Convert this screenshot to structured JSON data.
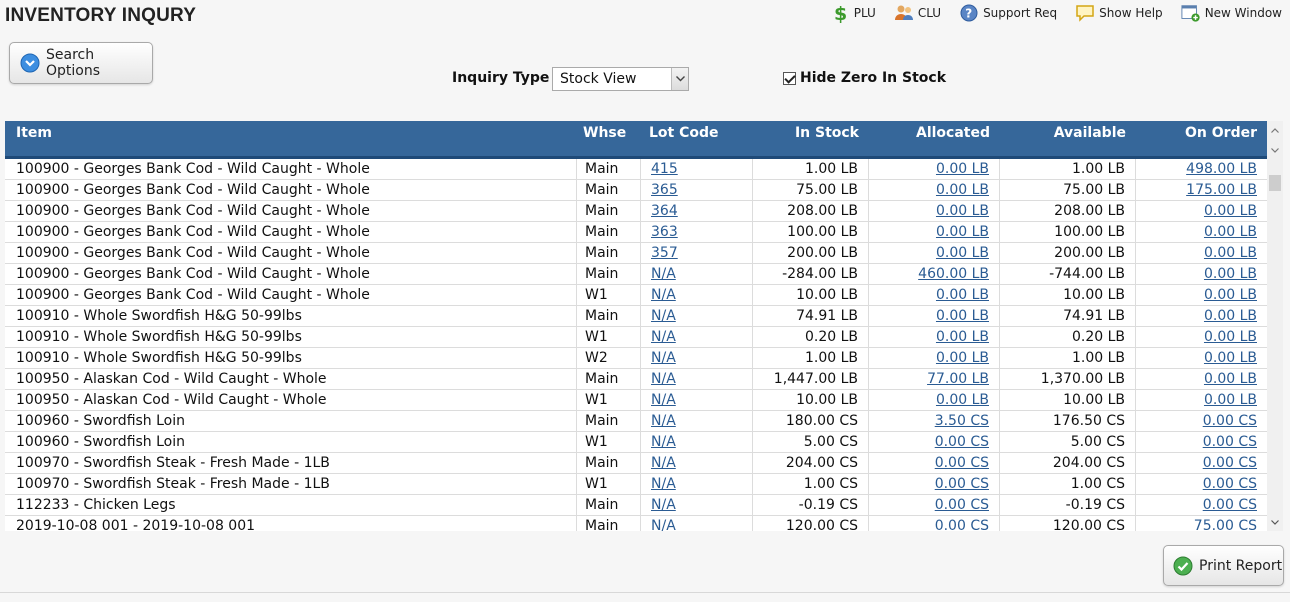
{
  "page": {
    "title": "INVENTORY INQURY"
  },
  "toolbar": {
    "items": [
      {
        "label": "PLU",
        "icon": "dollar-icon"
      },
      {
        "label": "CLU",
        "icon": "users-icon"
      },
      {
        "label": "Support Req",
        "icon": "help-circle-icon"
      },
      {
        "label": "Show Help",
        "icon": "speech-bubble-icon"
      },
      {
        "label": "New Window",
        "icon": "new-window-icon"
      }
    ]
  },
  "search_options": {
    "label": "Search Options"
  },
  "filters": {
    "inquiry_type_label": "Inquiry Type",
    "inquiry_type_value": "Stock View",
    "hide_zero_label": "Hide Zero In Stock",
    "hide_zero_checked": true
  },
  "table": {
    "headers": {
      "item": "Item",
      "whse": "Whse",
      "lot": "Lot Code",
      "instock": "In Stock",
      "allocated": "Allocated",
      "available": "Available",
      "onorder": "On Order"
    },
    "rows": [
      {
        "item": "100900 - Georges Bank Cod - Wild Caught - Whole",
        "whse": "Main",
        "lot": "415",
        "instock": "1.00 LB",
        "allocated": "0.00 LB",
        "available": "1.00 LB",
        "onorder": "498.00 LB"
      },
      {
        "item": "100900 - Georges Bank Cod - Wild Caught - Whole",
        "whse": "Main",
        "lot": "365",
        "instock": "75.00 LB",
        "allocated": "0.00 LB",
        "available": "75.00 LB",
        "onorder": "175.00 LB"
      },
      {
        "item": "100900 - Georges Bank Cod - Wild Caught - Whole",
        "whse": "Main",
        "lot": "364",
        "instock": "208.00 LB",
        "allocated": "0.00 LB",
        "available": "208.00 LB",
        "onorder": "0.00 LB"
      },
      {
        "item": "100900 - Georges Bank Cod - Wild Caught - Whole",
        "whse": "Main",
        "lot": "363",
        "instock": "100.00 LB",
        "allocated": "0.00 LB",
        "available": "100.00 LB",
        "onorder": "0.00 LB"
      },
      {
        "item": "100900 - Georges Bank Cod - Wild Caught - Whole",
        "whse": "Main",
        "lot": "357",
        "instock": "200.00 LB",
        "allocated": "0.00 LB",
        "available": "200.00 LB",
        "onorder": "0.00 LB"
      },
      {
        "item": "100900 - Georges Bank Cod - Wild Caught - Whole",
        "whse": "Main",
        "lot": "N/A",
        "instock": "-284.00 LB",
        "allocated": "460.00 LB",
        "available": "-744.00 LB",
        "onorder": "0.00 LB"
      },
      {
        "item": "100900 - Georges Bank Cod - Wild Caught - Whole",
        "whse": "W1",
        "lot": "N/A",
        "instock": "10.00 LB",
        "allocated": "0.00 LB",
        "available": "10.00 LB",
        "onorder": "0.00 LB"
      },
      {
        "item": "100910 - Whole Swordfish H&G 50-99lbs",
        "whse": "Main",
        "lot": "N/A",
        "instock": "74.91 LB",
        "allocated": "0.00 LB",
        "available": "74.91 LB",
        "onorder": "0.00 LB"
      },
      {
        "item": "100910 - Whole Swordfish H&G 50-99lbs",
        "whse": "W1",
        "lot": "N/A",
        "instock": "0.20 LB",
        "allocated": "0.00 LB",
        "available": "0.20 LB",
        "onorder": "0.00 LB"
      },
      {
        "item": "100910 - Whole Swordfish H&G 50-99lbs",
        "whse": "W2",
        "lot": "N/A",
        "instock": "1.00 LB",
        "allocated": "0.00 LB",
        "available": "1.00 LB",
        "onorder": "0.00 LB"
      },
      {
        "item": "100950 - Alaskan Cod - Wild Caught - Whole",
        "whse": "Main",
        "lot": "N/A",
        "instock": "1,447.00 LB",
        "allocated": "77.00 LB",
        "available": "1,370.00 LB",
        "onorder": "0.00 LB"
      },
      {
        "item": "100950 - Alaskan Cod - Wild Caught - Whole",
        "whse": "W1",
        "lot": "N/A",
        "instock": "10.00 LB",
        "allocated": "0.00 LB",
        "available": "10.00 LB",
        "onorder": "0.00 LB"
      },
      {
        "item": "100960 - Swordfish Loin",
        "whse": "Main",
        "lot": "N/A",
        "instock": "180.00 CS",
        "allocated": "3.50 CS",
        "available": "176.50 CS",
        "onorder": "0.00 CS"
      },
      {
        "item": "100960 - Swordfish Loin",
        "whse": "W1",
        "lot": "N/A",
        "instock": "5.00 CS",
        "allocated": "0.00 CS",
        "available": "5.00 CS",
        "onorder": "0.00 CS"
      },
      {
        "item": "100970 - Swordfish Steak - Fresh Made - 1LB",
        "whse": "Main",
        "lot": "N/A",
        "instock": "204.00 CS",
        "allocated": "0.00 CS",
        "available": "204.00 CS",
        "onorder": "0.00 CS"
      },
      {
        "item": "100970 - Swordfish Steak - Fresh Made - 1LB",
        "whse": "W1",
        "lot": "N/A",
        "instock": "1.00 CS",
        "allocated": "0.00 CS",
        "available": "1.00 CS",
        "onorder": "0.00 CS"
      },
      {
        "item": "112233 - Chicken Legs",
        "whse": "Main",
        "lot": "N/A",
        "instock": "-0.19 CS",
        "allocated": "0.00 CS",
        "available": "-0.19 CS",
        "onorder": "0.00 CS"
      },
      {
        "item": "2019-10-08 001 - 2019-10-08 001",
        "whse": "Main",
        "lot": "N/A",
        "instock": "120.00 CS",
        "allocated": "0.00 CS",
        "available": "120.00 CS",
        "onorder": "75.00 CS"
      }
    ]
  },
  "print_report": {
    "label": "Print Report"
  },
  "colors": {
    "header_bg": "#36679a",
    "link": "#2a5b93"
  }
}
